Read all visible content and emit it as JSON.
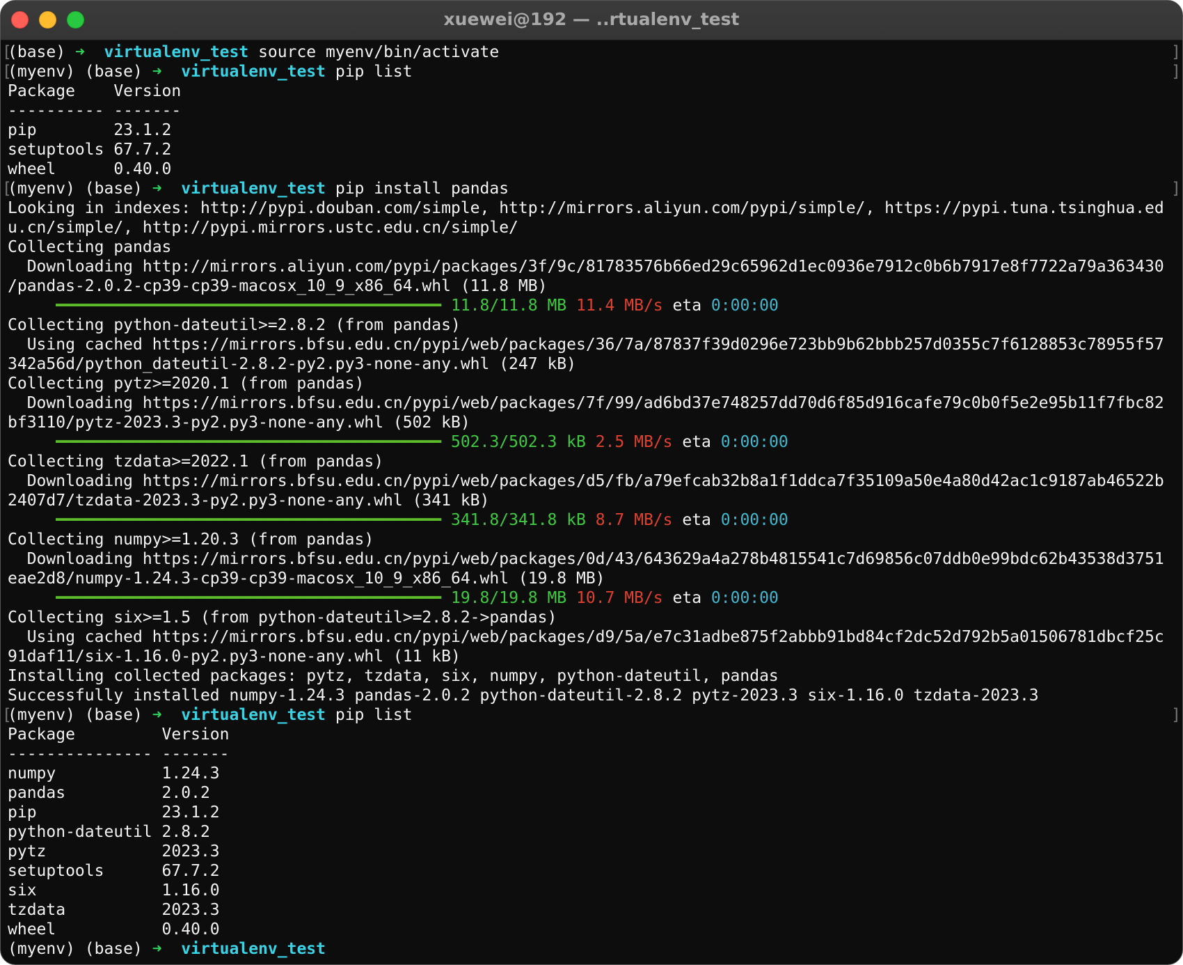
{
  "window": {
    "title": "xuewei@192 — ..rtualenv_test"
  },
  "colors": {
    "background": "#0d0d0d",
    "text": "#f2f2f2",
    "prompt_arrow": "#2fd35a",
    "prompt_dir": "#39d3e6",
    "progress_green": "#3fc93f",
    "speed_red": "#e0402c",
    "eta_cyan": "#3fb8cf"
  },
  "prompt": {
    "arrow": "➜",
    "dir": "virtualenv_test"
  },
  "lines": [
    {
      "kind": "prompt",
      "prefix": "(base) ",
      "cmd": " source myenv/bin/activate"
    },
    {
      "kind": "prompt",
      "prefix": "(myenv) (base) ",
      "cmd": " pip list"
    },
    {
      "kind": "text",
      "text": "Package    Version"
    },
    {
      "kind": "text",
      "text": "---------- -------"
    },
    {
      "kind": "text",
      "text": "pip        23.1.2"
    },
    {
      "kind": "text",
      "text": "setuptools 67.7.2"
    },
    {
      "kind": "text",
      "text": "wheel      0.40.0"
    },
    {
      "kind": "prompt",
      "prefix": "(myenv) (base) ",
      "cmd": " pip install pandas"
    },
    {
      "kind": "text",
      "text": "Looking in indexes: http://pypi.douban.com/simple, http://mirrors.aliyun.com/pypi/simple/, https://pypi.tuna.tsinghua.ed"
    },
    {
      "kind": "text",
      "text": "u.cn/simple/, http://pypi.mirrors.ustc.edu.cn/simple/"
    },
    {
      "kind": "text",
      "text": "Collecting pandas"
    },
    {
      "kind": "text",
      "text": "  Downloading http://mirrors.aliyun.com/pypi/packages/3f/9c/81783576b66ed29c65962d1ec0936e7912c0b6b7917e8f7722a79a363430"
    },
    {
      "kind": "text",
      "text": "/pandas-2.0.2-cp39-cp39-macosx_10_9_x86_64.whl (11.8 MB)"
    },
    {
      "kind": "progress",
      "bar": "     ━━━━━━━━━━━━━━━━━━━━━━━━━━━━━━━━━━━━━━━━ ",
      "size": "11.8/11.8 MB",
      "speed": "11.4 MB/s",
      "eta_label": "eta",
      "eta": "0:00:00"
    },
    {
      "kind": "text",
      "text": "Collecting python-dateutil>=2.8.2 (from pandas)"
    },
    {
      "kind": "text",
      "text": "  Using cached https://mirrors.bfsu.edu.cn/pypi/web/packages/36/7a/87837f39d0296e723bb9b62bbb257d0355c7f6128853c78955f57"
    },
    {
      "kind": "text",
      "text": "342a56d/python_dateutil-2.8.2-py2.py3-none-any.whl (247 kB)"
    },
    {
      "kind": "text",
      "text": "Collecting pytz>=2020.1 (from pandas)"
    },
    {
      "kind": "text",
      "text": "  Downloading https://mirrors.bfsu.edu.cn/pypi/web/packages/7f/99/ad6bd37e748257dd70d6f85d916cafe79c0b0f5e2e95b11f7fbc82"
    },
    {
      "kind": "text",
      "text": "bf3110/pytz-2023.3-py2.py3-none-any.whl (502 kB)"
    },
    {
      "kind": "progress",
      "bar": "     ━━━━━━━━━━━━━━━━━━━━━━━━━━━━━━━━━━━━━━━━ ",
      "size": "502.3/502.3 kB",
      "speed": "2.5 MB/s",
      "eta_label": "eta",
      "eta": "0:00:00"
    },
    {
      "kind": "text",
      "text": "Collecting tzdata>=2022.1 (from pandas)"
    },
    {
      "kind": "text",
      "text": "  Downloading https://mirrors.bfsu.edu.cn/pypi/web/packages/d5/fb/a79efcab32b8a1f1ddca7f35109a50e4a80d42ac1c9187ab46522b"
    },
    {
      "kind": "text",
      "text": "2407d7/tzdata-2023.3-py2.py3-none-any.whl (341 kB)"
    },
    {
      "kind": "progress",
      "bar": "     ━━━━━━━━━━━━━━━━━━━━━━━━━━━━━━━━━━━━━━━━ ",
      "size": "341.8/341.8 kB",
      "speed": "8.7 MB/s",
      "eta_label": "eta",
      "eta": "0:00:00"
    },
    {
      "kind": "text",
      "text": "Collecting numpy>=1.20.3 (from pandas)"
    },
    {
      "kind": "text",
      "text": "  Downloading https://mirrors.bfsu.edu.cn/pypi/web/packages/0d/43/643629a4a278b4815541c7d69856c07ddb0e99bdc62b43538d3751"
    },
    {
      "kind": "text",
      "text": "eae2d8/numpy-1.24.3-cp39-cp39-macosx_10_9_x86_64.whl (19.8 MB)"
    },
    {
      "kind": "progress",
      "bar": "     ━━━━━━━━━━━━━━━━━━━━━━━━━━━━━━━━━━━━━━━━ ",
      "size": "19.8/19.8 MB",
      "speed": "10.7 MB/s",
      "eta_label": "eta",
      "eta": "0:00:00"
    },
    {
      "kind": "text",
      "text": "Collecting six>=1.5 (from python-dateutil>=2.8.2->pandas)"
    },
    {
      "kind": "text",
      "text": "  Using cached https://mirrors.bfsu.edu.cn/pypi/web/packages/d9/5a/e7c31adbe875f2abbb91bd84cf2dc52d792b5a01506781dbcf25c"
    },
    {
      "kind": "text",
      "text": "91daf11/six-1.16.0-py2.py3-none-any.whl (11 kB)"
    },
    {
      "kind": "text",
      "text": "Installing collected packages: pytz, tzdata, six, numpy, python-dateutil, pandas"
    },
    {
      "kind": "text",
      "text": "Successfully installed numpy-1.24.3 pandas-2.0.2 python-dateutil-2.8.2 pytz-2023.3 six-1.16.0 tzdata-2023.3"
    },
    {
      "kind": "prompt",
      "prefix": "(myenv) (base) ",
      "cmd": " pip list"
    },
    {
      "kind": "text",
      "text": "Package         Version"
    },
    {
      "kind": "text",
      "text": "--------------- -------"
    },
    {
      "kind": "text",
      "text": "numpy           1.24.3"
    },
    {
      "kind": "text",
      "text": "pandas          2.0.2"
    },
    {
      "kind": "text",
      "text": "pip             23.1.2"
    },
    {
      "kind": "text",
      "text": "python-dateutil 2.8.2"
    },
    {
      "kind": "text",
      "text": "pytz            2023.3"
    },
    {
      "kind": "text",
      "text": "setuptools      67.7.2"
    },
    {
      "kind": "text",
      "text": "six             1.16.0"
    },
    {
      "kind": "text",
      "text": "tzdata          2023.3"
    },
    {
      "kind": "text",
      "text": "wheel           0.40.0"
    },
    {
      "kind": "prompt_open",
      "prefix": "(myenv) (base) ",
      "cmd": ""
    }
  ]
}
